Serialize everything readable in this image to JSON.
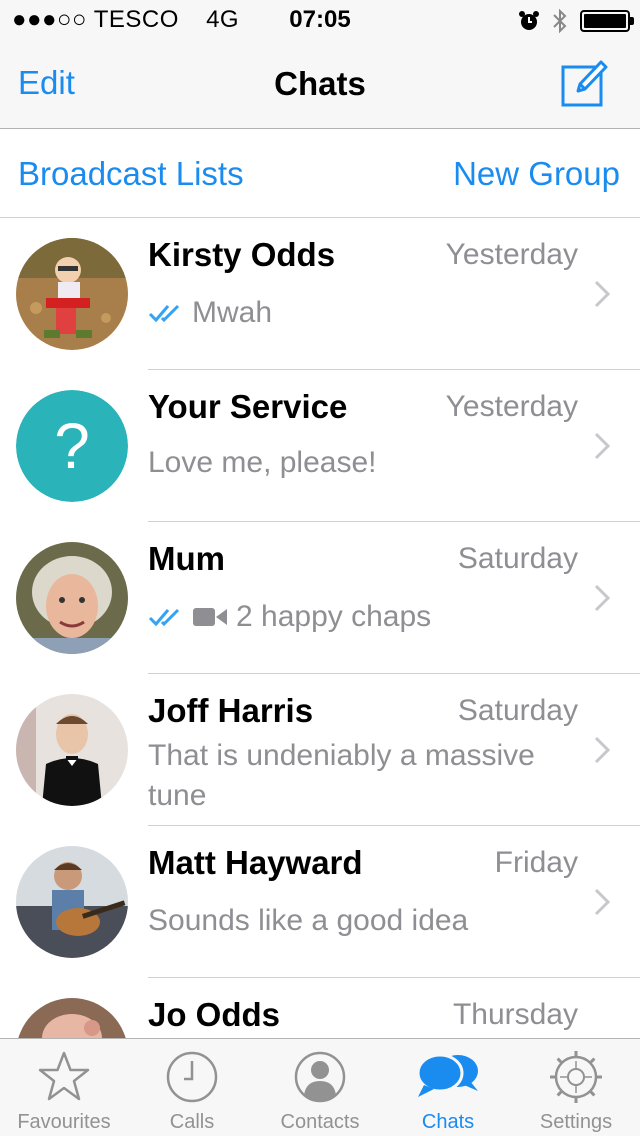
{
  "status_bar": {
    "carrier": "●●●○○ TESCO",
    "network": "4G",
    "time": "07:05"
  },
  "nav": {
    "edit_label": "Edit",
    "title": "Chats"
  },
  "sub_bar": {
    "broadcast_label": "Broadcast Lists",
    "new_group_label": "New Group"
  },
  "chats": [
    {
      "name": "Kirsty Odds",
      "time": "Yesterday",
      "preview": "Mwah",
      "read_ticks": true,
      "video": false
    },
    {
      "name": "Your Service",
      "time": "Yesterday",
      "preview": "Love me, please!",
      "read_ticks": false,
      "video": false
    },
    {
      "name": "Mum",
      "time": "Saturday",
      "preview": "2 happy chaps",
      "read_ticks": true,
      "video": true
    },
    {
      "name": "Joff Harris",
      "time": "Saturday",
      "preview": "That is undeniably a massive tune",
      "read_ticks": false,
      "video": false
    },
    {
      "name": "Matt Hayward",
      "time": "Friday",
      "preview": "Sounds like a good idea",
      "read_ticks": false,
      "video": false
    },
    {
      "name": "Jo Odds",
      "time": "Thursday",
      "preview": "",
      "read_ticks": false,
      "video": false
    }
  ],
  "tabs": [
    {
      "label": "Favourites",
      "icon": "star-icon"
    },
    {
      "label": "Calls",
      "icon": "clock-icon"
    },
    {
      "label": "Contacts",
      "icon": "person-icon"
    },
    {
      "label": "Chats",
      "icon": "chat-bubbles-icon",
      "active": true
    },
    {
      "label": "Settings",
      "icon": "gear-icon"
    }
  ],
  "colors": {
    "accent": "#1a8cf0",
    "secondary_text": "#8e8e93",
    "tab_inactive": "#929292",
    "unknown_avatar": "#2ab3b8"
  }
}
